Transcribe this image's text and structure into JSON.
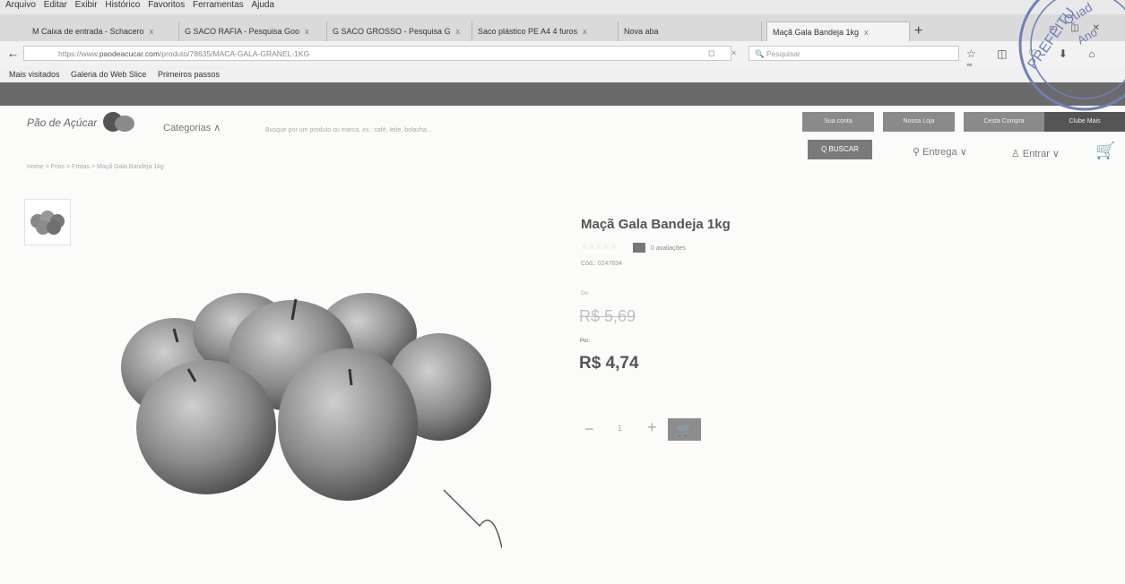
{
  "browser": {
    "menu": [
      "Arquivo",
      "Editar",
      "Exibir",
      "Histórico",
      "Favoritos",
      "Ferramentas",
      "Ajuda"
    ],
    "tabs": [
      {
        "label": "M Caixa de entrada - Schacero",
        "close": "x"
      },
      {
        "label": "G SACO RAFIA - Pesquisa Goo",
        "close": "x"
      },
      {
        "label": "G SACO GROSSO - Pesquisa G",
        "close": "x"
      },
      {
        "label": "Saco plástico PE A4 4 furos",
        "close": "x"
      },
      {
        "label": "Nova aba",
        "close": ""
      },
      {
        "label": "Maçã Gala Bandeja 1kg",
        "close": "x"
      }
    ],
    "new_tab": "+",
    "back": "←",
    "url_prefix": "https://www.",
    "url_domain": "paodeacucar.com",
    "url_path": "/produto/78635/MACA-GALA-GRANEL-1KG",
    "search_placeholder": "Pesquisar",
    "toolbar_icons": "☆ ◫ ♡ ⬇ ⌂ ≡",
    "url_icons": "◻ ×",
    "bookmarks": [
      "Mais visitados",
      "Galeria do Web Slice",
      "Primeiros passos"
    ]
  },
  "site": {
    "logo": "Pão de Açúcar",
    "top_links": [
      "Sua conta",
      "Nossa Loja",
      "Cesta Compra",
      "Clube Mais"
    ],
    "categories": "Categorias ∧",
    "search_placeholder": "Busque por um produto ou marca, ex.: café, leite, bolacha...",
    "search_button": "Q BUSCAR",
    "entrega": "Entrega ∨",
    "entrar": "Entrar ∨",
    "cart": "🛒",
    "breadcrumb": "Home  >  Frios  >  Frutas  >  Maçã Gala Bandeja 1kg"
  },
  "product": {
    "title": "Maçã Gala Bandeja 1kg",
    "stars": "☆☆☆☆☆",
    "reviews": "0 avaliações",
    "code": "Cód.: 0247834",
    "de_label": "De:",
    "old_price": "R$ 5,69",
    "por_label": "Por:",
    "price": "R$ 4,74",
    "qty_minus": "−",
    "qty_value": "1",
    "qty_plus": "+",
    "add_to_cart": "🛒"
  },
  "stamp_text": "PREFEITURA Quad... Ano D..."
}
